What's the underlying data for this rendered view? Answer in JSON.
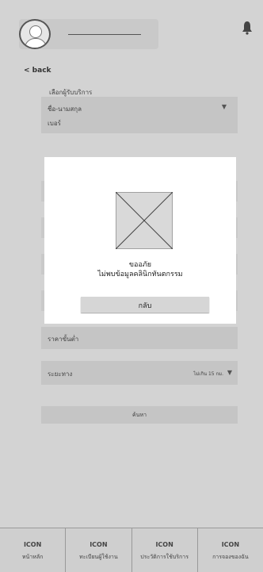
{
  "header": {
    "avatar": "user-avatar-icon",
    "bell": "bell-icon"
  },
  "nav": {
    "back": "< back"
  },
  "form": {
    "select_label": "เลือกผู้รับบริการ",
    "select_line1": "ชื่อ-นามสกุล",
    "select_line2": "เบอร์",
    "price_label": "ราคาขั้นต่ำ",
    "distance_label": "ระยะทาง",
    "distance_value": "ไม่เกิน 15 กม.",
    "search_label": "ค้นหา"
  },
  "modal": {
    "image": "image-placeholder-icon",
    "line1": "ขออภัย",
    "line2": "ไม่พบข้อมูลคลินิกทันตกรรม",
    "button": "กลับ"
  },
  "tabs": [
    {
      "icon": "ICON",
      "label": "หน้าหลัก"
    },
    {
      "icon": "ICON",
      "label": "ทะเบียนผู้ใช้งาน"
    },
    {
      "icon": "ICON",
      "label": "ประวัติการใช้บริการ"
    },
    {
      "icon": "ICON",
      "label": "การจองของฉัน"
    }
  ]
}
